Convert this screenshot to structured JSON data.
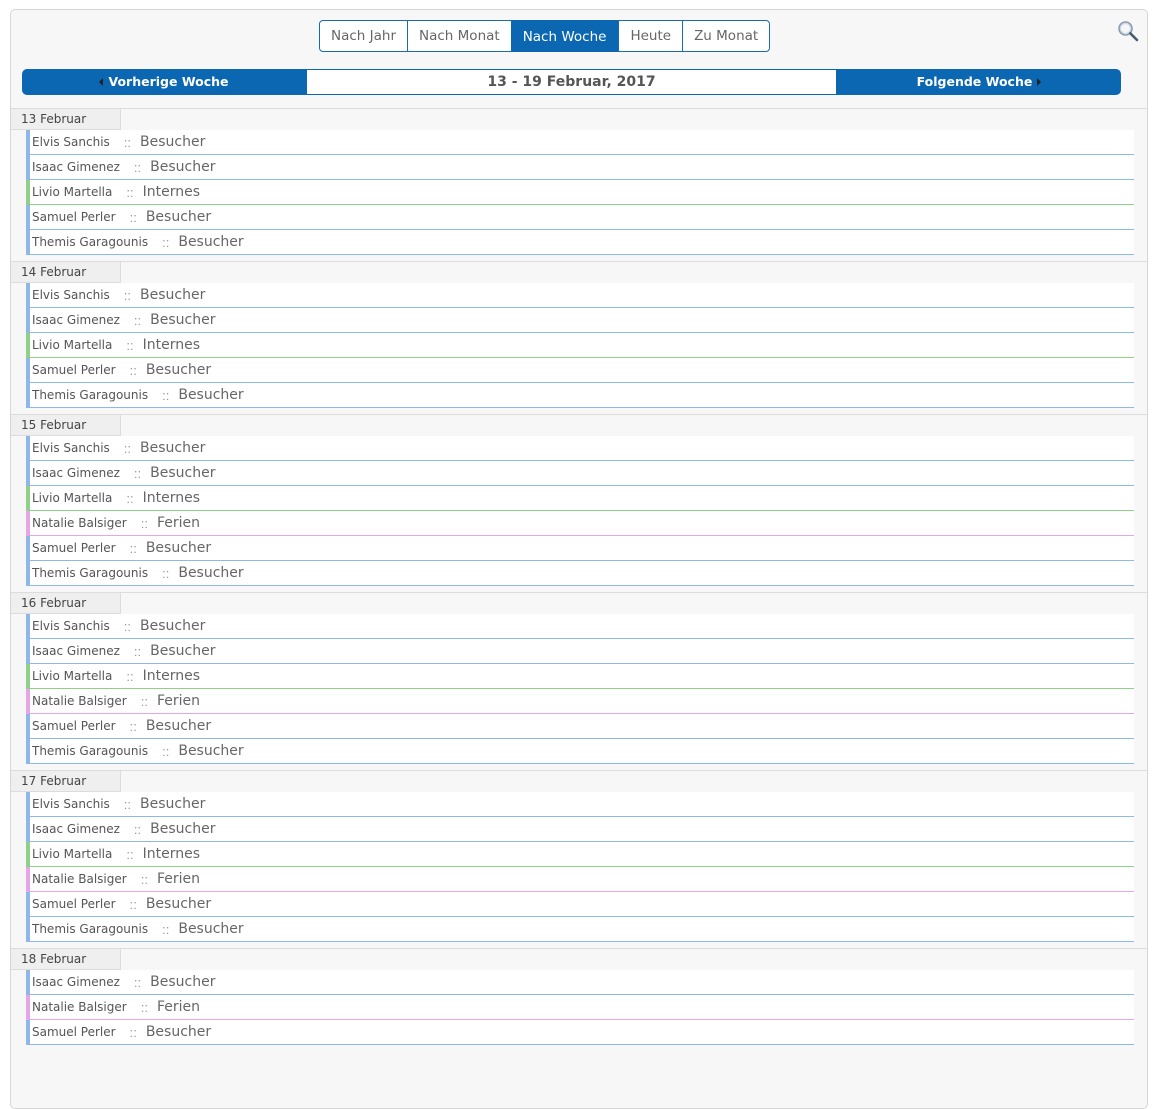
{
  "views": [
    "Nach Jahr",
    "Nach Monat",
    "Nach Woche",
    "Heute",
    "Zu Monat"
  ],
  "active_view": "Nach Woche",
  "nav": {
    "prev_label": "Vorherige Woche",
    "title": "13 - 19 Februar, 2017",
    "next_label": "Folgende Woche"
  },
  "colors": {
    "accent": "#0b67b2",
    "besucher": "#8fb7e8",
    "internes": "#8fd18a",
    "ferien": "#e6a6e6"
  },
  "separator": "::",
  "days": [
    {
      "label": "13 Februar",
      "entries": [
        {
          "name": "Elvis Sanchis",
          "type": "Besucher"
        },
        {
          "name": "Isaac Gimenez",
          "type": "Besucher"
        },
        {
          "name": "Livio Martella",
          "type": "Internes"
        },
        {
          "name": "Samuel Perler",
          "type": "Besucher"
        },
        {
          "name": "Themis Garagounis",
          "type": "Besucher"
        }
      ]
    },
    {
      "label": "14 Februar",
      "entries": [
        {
          "name": "Elvis Sanchis",
          "type": "Besucher"
        },
        {
          "name": "Isaac Gimenez",
          "type": "Besucher"
        },
        {
          "name": "Livio Martella",
          "type": "Internes"
        },
        {
          "name": "Samuel Perler",
          "type": "Besucher"
        },
        {
          "name": "Themis Garagounis",
          "type": "Besucher"
        }
      ]
    },
    {
      "label": "15 Februar",
      "entries": [
        {
          "name": "Elvis Sanchis",
          "type": "Besucher"
        },
        {
          "name": "Isaac Gimenez",
          "type": "Besucher"
        },
        {
          "name": "Livio Martella",
          "type": "Internes"
        },
        {
          "name": "Natalie Balsiger",
          "type": "Ferien"
        },
        {
          "name": "Samuel Perler",
          "type": "Besucher"
        },
        {
          "name": "Themis Garagounis",
          "type": "Besucher"
        }
      ]
    },
    {
      "label": "16 Februar",
      "entries": [
        {
          "name": "Elvis Sanchis",
          "type": "Besucher"
        },
        {
          "name": "Isaac Gimenez",
          "type": "Besucher"
        },
        {
          "name": "Livio Martella",
          "type": "Internes"
        },
        {
          "name": "Natalie Balsiger",
          "type": "Ferien"
        },
        {
          "name": "Samuel Perler",
          "type": "Besucher"
        },
        {
          "name": "Themis Garagounis",
          "type": "Besucher"
        }
      ]
    },
    {
      "label": "17 Februar",
      "entries": [
        {
          "name": "Elvis Sanchis",
          "type": "Besucher"
        },
        {
          "name": "Isaac Gimenez",
          "type": "Besucher"
        },
        {
          "name": "Livio Martella",
          "type": "Internes"
        },
        {
          "name": "Natalie Balsiger",
          "type": "Ferien"
        },
        {
          "name": "Samuel Perler",
          "type": "Besucher"
        },
        {
          "name": "Themis Garagounis",
          "type": "Besucher"
        }
      ]
    },
    {
      "label": "18 Februar",
      "entries": [
        {
          "name": "Isaac Gimenez",
          "type": "Besucher"
        },
        {
          "name": "Natalie Balsiger",
          "type": "Ferien"
        },
        {
          "name": "Samuel Perler",
          "type": "Besucher"
        }
      ]
    }
  ]
}
